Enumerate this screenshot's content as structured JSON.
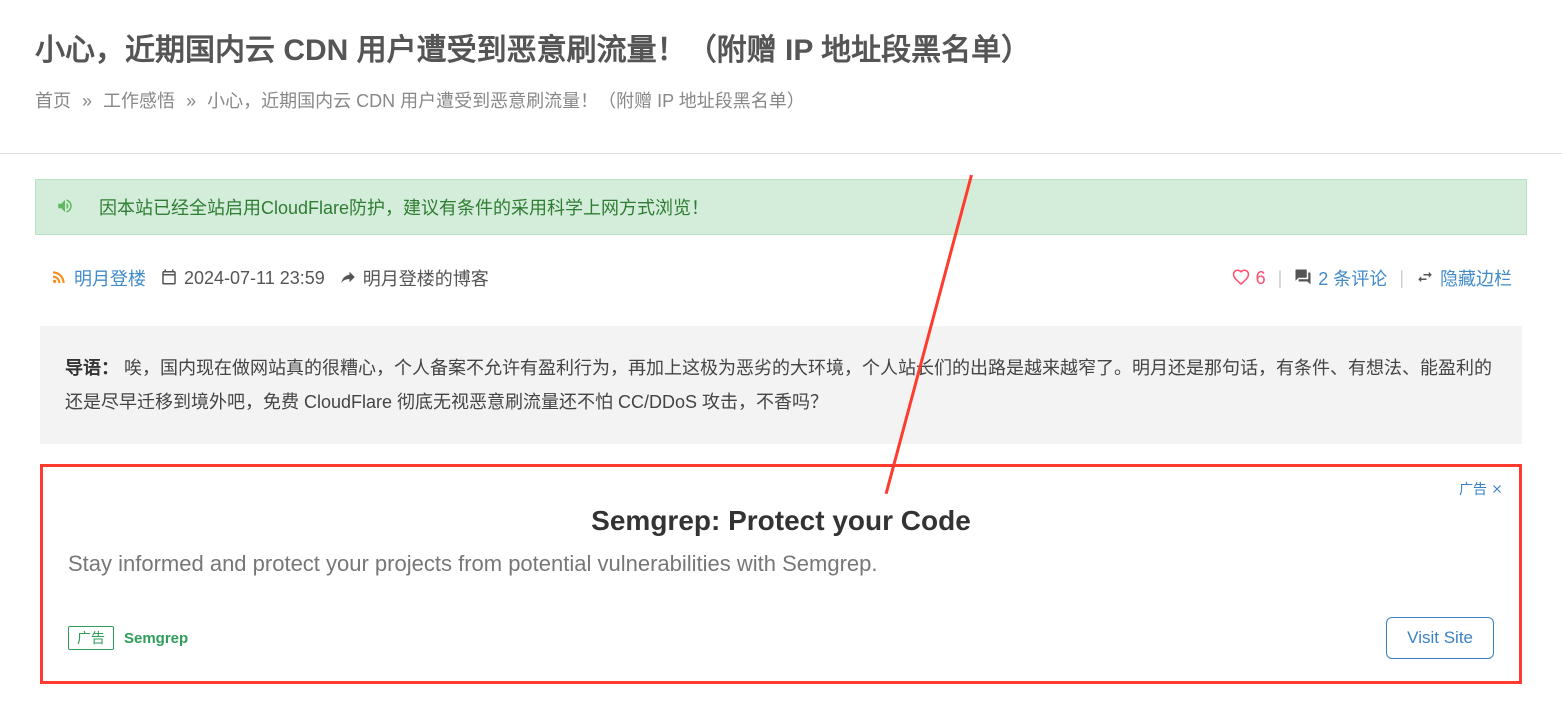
{
  "page": {
    "title": "小心，近期国内云 CDN 用户遭受到恶意刷流量！（附赠 IP 地址段黑名单）"
  },
  "breadcrumb": {
    "home": "首页",
    "sep": "»",
    "category": "工作感悟",
    "current": "小心，近期国内云 CDN 用户遭受到恶意刷流量！（附赠 IP 地址段黑名单）"
  },
  "alert": {
    "text": "因本站已经全站启用CloudFlare防护，建议有条件的采用科学上网方式浏览！"
  },
  "meta": {
    "author": "明月登楼",
    "date": "2024-07-11 23:59",
    "blog": "明月登楼的博客",
    "likes": "6",
    "comments": "2 条评论",
    "sidebar_toggle": "隐藏边栏"
  },
  "intro": {
    "label": "导语：",
    "text": "唉，国内现在做网站真的很糟心，个人备案不允许有盈利行为，再加上这极为恶劣的大环境，个人站长们的出路是越来越窄了。明月还是那句话，有条件、有想法、能盈利的还是尽早迁移到境外吧，免费 CloudFlare 彻底无视恶意刷流量还不怕 CC/DDoS 攻击，不香吗？"
  },
  "ad": {
    "close_label": "广告",
    "title": "Semgrep: Protect your Code",
    "subtitle": "Stay informed and protect your projects from potential vulnerabilities with Semgrep.",
    "badge": "广告",
    "sponsor": "Semgrep",
    "cta": "Visit Site"
  }
}
